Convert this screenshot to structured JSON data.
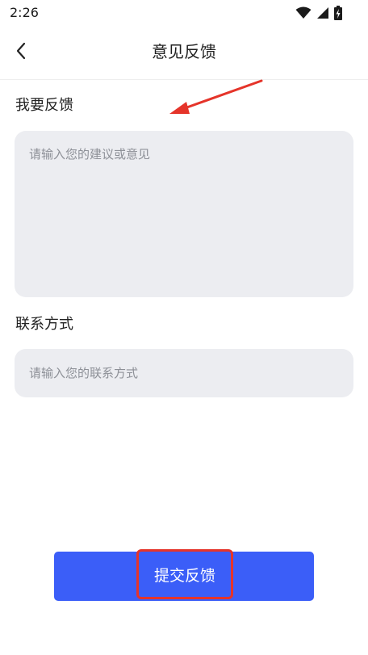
{
  "status_bar": {
    "time": "2:26",
    "icons": [
      "wifi-icon",
      "cellular-signal-icon",
      "battery-charging-icon"
    ]
  },
  "header": {
    "back_icon": "chevron-left-icon",
    "title": "意见反馈"
  },
  "feedback": {
    "label": "我要反馈",
    "value": "",
    "placeholder": "请输入您的建议或意见"
  },
  "contact": {
    "label": "联系方式",
    "value": "",
    "placeholder": "请输入您的联系方式"
  },
  "submit": {
    "label": "提交反馈"
  },
  "colors": {
    "accent": "#3b5ef8",
    "input_background": "#ecedf1",
    "annotation": "#e5342a"
  }
}
